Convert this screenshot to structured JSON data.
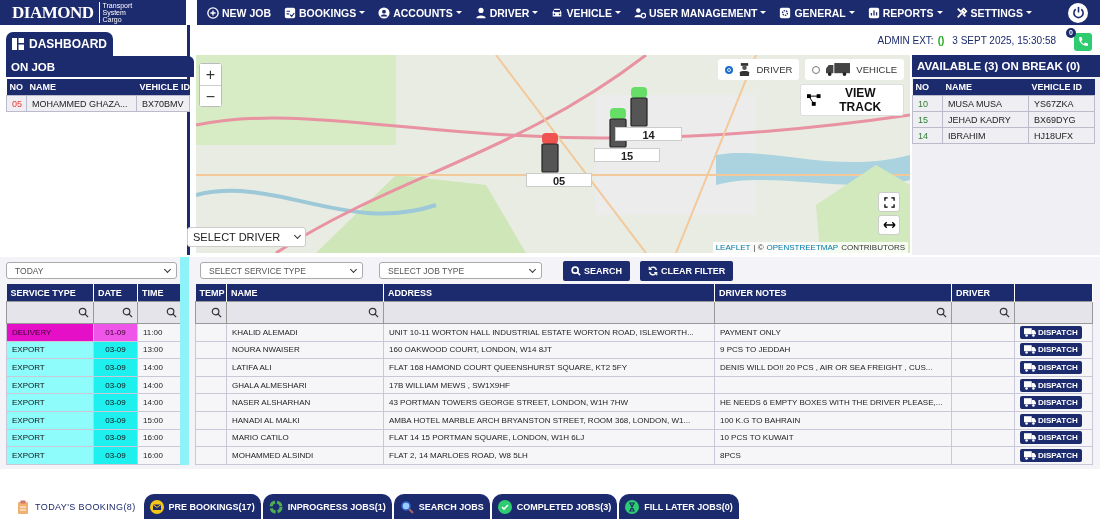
{
  "brand": {
    "name": "DIAMOND",
    "tagline": [
      "Transport",
      "System",
      "Cargo"
    ]
  },
  "nav": [
    {
      "label": "NEW JOB",
      "has_menu": false
    },
    {
      "label": "BOOKINGS",
      "has_menu": true
    },
    {
      "label": "ACCOUNTS",
      "has_menu": true
    },
    {
      "label": "DRIVER",
      "has_menu": true
    },
    {
      "label": "VEHICLE",
      "has_menu": true
    },
    {
      "label": "USER MANAGEMENT",
      "has_menu": true
    },
    {
      "label": "GENERAL",
      "has_menu": true
    },
    {
      "label": "REPORTS",
      "has_menu": true
    },
    {
      "label": "SETTINGS",
      "has_menu": true
    }
  ],
  "dashboard_tab": "DASHBOARD",
  "on_job": {
    "title": "ON JOB",
    "columns": [
      "NO",
      "NAME",
      "VEHICLE ID"
    ],
    "rows": [
      {
        "no": "05",
        "name": "MOHAMMED GHAZA...",
        "vehicle_id": "BX70BMV"
      }
    ]
  },
  "status": {
    "admin_ext_label": "ADMIN EXT:",
    "admin_ext_value": "()",
    "datetime": "3 SEPT 2025, 15:30:58",
    "call_badge": "0"
  },
  "map": {
    "kind": "picture",
    "markers": [
      {
        "label": "05",
        "color": "#ef5350"
      },
      {
        "label": "15",
        "color": "#66dd66"
      },
      {
        "label": "14",
        "color": "#66dd66"
      }
    ],
    "zoom_in": "+",
    "zoom_out": "−",
    "track_modes": [
      {
        "label": "DRIVER",
        "selected": true
      },
      {
        "label": "VEHICLE",
        "selected": false
      }
    ],
    "view_track": "VIEW TRACK",
    "driver_select": "SELECT DRIVER",
    "attribution_link_1": "LEAFLET",
    "attribution_sep": "| ©",
    "attribution_link_2": "OPENSTREETMAP",
    "attribution_tail": "CONTRIBUTORS"
  },
  "available": {
    "title": "AVAILABLE (3) ON BREAK (0)",
    "columns": [
      "NO",
      "NAME",
      "VEHICLE ID"
    ],
    "rows": [
      {
        "no": "10",
        "name": "MUSA MUSA",
        "vehicle_id": "YS67ZKA"
      },
      {
        "no": "15",
        "name": "JEHAD KADRY",
        "vehicle_id": "BX69DYG"
      },
      {
        "no": "14",
        "name": "IBRAHIM",
        "vehicle_id": "HJ18UFX"
      }
    ]
  },
  "filters": {
    "period": "TODAY",
    "service_type": "SELECT SERVICE TYPE",
    "job_type": "SELECT JOB TYPE",
    "search_button": "SEARCH",
    "clear_button": "CLEAR FILTER"
  },
  "jobs": {
    "columns": [
      "SERVICE TYPE",
      "DATE",
      "TIME",
      "TEMP",
      "NAME",
      "ADDRESS",
      "DRIVER NOTES",
      "DRIVER"
    ],
    "rows": [
      {
        "kind": "delivery",
        "service_type": "DELIVERY",
        "date": "01-09",
        "time": "11:00",
        "name": "KHALID ALEMADI",
        "address": "UNIT 10-11 WORTON HALL INDUSTRIAL ESTATE WORTON ROAD, ISLEWORTH...",
        "driver_notes": "PAYMENT ONLY",
        "action": "DISPATCH"
      },
      {
        "kind": "export",
        "service_type": "EXPORT",
        "date": "03-09",
        "time": "13:00",
        "name": "NOURA NWAISER",
        "address": "160 OAKWOOD COURT, LONDON, W14 8JT",
        "driver_notes": "9 PCS TO JEDDAH",
        "action": "DISPATCH"
      },
      {
        "kind": "export",
        "service_type": "EXPORT",
        "date": "03-09",
        "time": "14:00",
        "name": "LATIFA ALI",
        "address": "FLAT 168 HAMOND COURT QUEENSHURST SQUARE, KT2 5FY",
        "driver_notes": "DENIS WILL DO!! 20 PCS , AIR OR SEA FREIGHT , CUS...",
        "action": "DISPATCH"
      },
      {
        "kind": "export",
        "service_type": "EXPORT",
        "date": "03-09",
        "time": "14:00",
        "name": "GHALA ALMESHARI",
        "address": "17B WILLIAM MEWS , SW1X9HF",
        "action": "DISPATCH"
      },
      {
        "kind": "export",
        "service_type": "EXPORT",
        "date": "03-09",
        "time": "14:00",
        "name": "NASER ALSHARHAN",
        "address": "43 PORTMAN TOWERS GEORGE STREET, LONDON, W1H 7HW",
        "driver_notes": "HE NEEDS 6 EMPTY BOXES WITH THE DRIVER PLEASE,...",
        "action": "DISPATCH"
      },
      {
        "kind": "export",
        "service_type": "EXPORT",
        "date": "03-09",
        "time": "15:00",
        "name": "HANADI AL MALKI",
        "address": "AMBA HOTEL MARBLE ARCH BRYANSTON STREET, ROOM 368, LONDON, W1...",
        "driver_notes": "100 K.G TO BAHRAIN",
        "action": "DISPATCH"
      },
      {
        "kind": "export",
        "service_type": "EXPORT",
        "date": "03-09",
        "time": "16:00",
        "name": "MARIO CATILO",
        "address": "FLAT 14 15 PORTMAN SQUARE, LONDON, W1H 6LJ",
        "driver_notes": "10 PCS TO KUWAIT",
        "action": "DISPATCH"
      },
      {
        "kind": "export",
        "service_type": "EXPORT",
        "date": "03-09",
        "time": "16:00",
        "name": "MOHAMMED ALSINDI",
        "address": "FLAT 2, 14 MARLOES ROAD, W8 5LH",
        "driver_notes": "8PCS",
        "action": "DISPATCH"
      }
    ]
  },
  "bottom_tabs": [
    {
      "label": "TODAY'S BOOKING(8)",
      "selected": true
    },
    {
      "label": "PRE BOOKINGS(17)",
      "selected": false
    },
    {
      "label": "INPROGRESS JOBS(1)",
      "selected": false
    },
    {
      "label": "SEARCH JOBS",
      "selected": false
    },
    {
      "label": "COMPLETED JOBS(3)",
      "selected": false
    },
    {
      "label": "FILL LATER JOBS(0)",
      "selected": false
    }
  ]
}
